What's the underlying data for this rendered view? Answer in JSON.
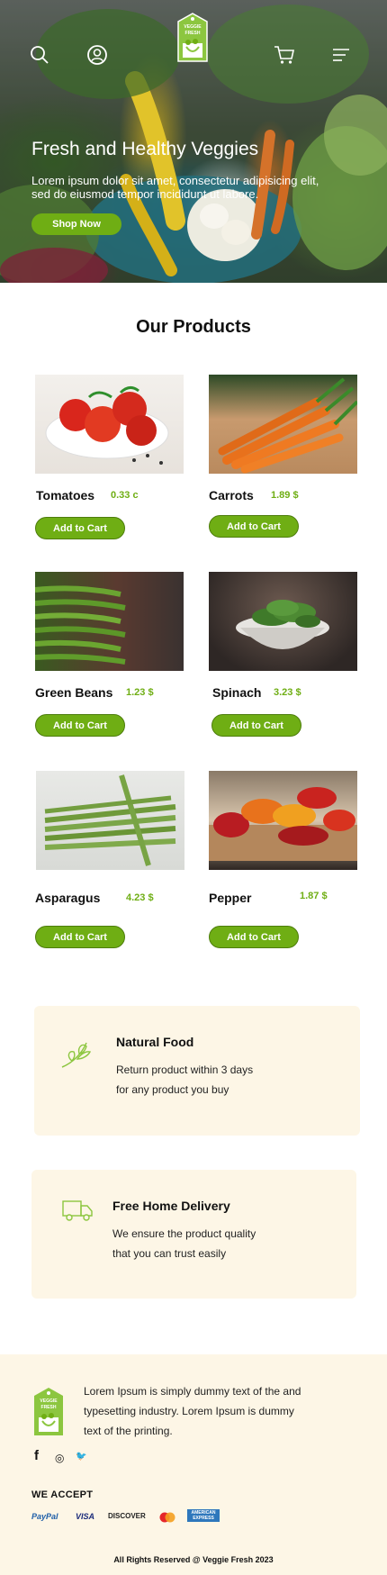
{
  "header": {
    "logo_text": [
      "VEGGIE",
      "FRESH"
    ],
    "icons": [
      "search-icon",
      "user-icon",
      "cart-icon",
      "menu-icon"
    ]
  },
  "hero": {
    "title": "Fresh and Healthy Veggies",
    "text": "Lorem ipsum dolor sit amet, consectetur adipisicing elit, sed do eiusmod tempor incididunt ut labore.",
    "button": "Shop Now"
  },
  "products_section": {
    "title": "Our Products",
    "add_to_cart_label": "Add to Cart",
    "items": [
      {
        "name": "Tomatoes",
        "price": "0.33 c"
      },
      {
        "name": "Carrots",
        "price": "1.89 $"
      },
      {
        "name": "Green Beans",
        "price": "1.23 $"
      },
      {
        "name": "Spinach",
        "price": "3.23 $"
      },
      {
        "name": "Asparagus",
        "price": "4.23 $"
      },
      {
        "name": "Pepper",
        "price": "1.87 $"
      }
    ]
  },
  "features": [
    {
      "title": "Natural Food",
      "line1": "Return product within 3 days",
      "line2": "for any product you buy",
      "icon": "leaf-icon"
    },
    {
      "title": "Free Home Delivery",
      "line1": "We ensure the product quality",
      "line2": "that you can trust easily",
      "icon": "delivery-truck-icon"
    }
  ],
  "footer": {
    "text": "Lorem Ipsum is simply dummy text of the and typesetting industry. Lorem Ipsum is dummy text of the printing.",
    "social": [
      "f",
      "◎",
      "🐦"
    ],
    "accept_label": "WE ACCEPT",
    "payments": [
      "PayPal",
      "VISA",
      "DISCOVER",
      "",
      "AMERICAN EXPRESS"
    ],
    "copyright": "All Rights Reserved @ Veggie Fresh 2023"
  },
  "colors": {
    "accent": "#6fae14",
    "cream": "#fdf6e6"
  }
}
